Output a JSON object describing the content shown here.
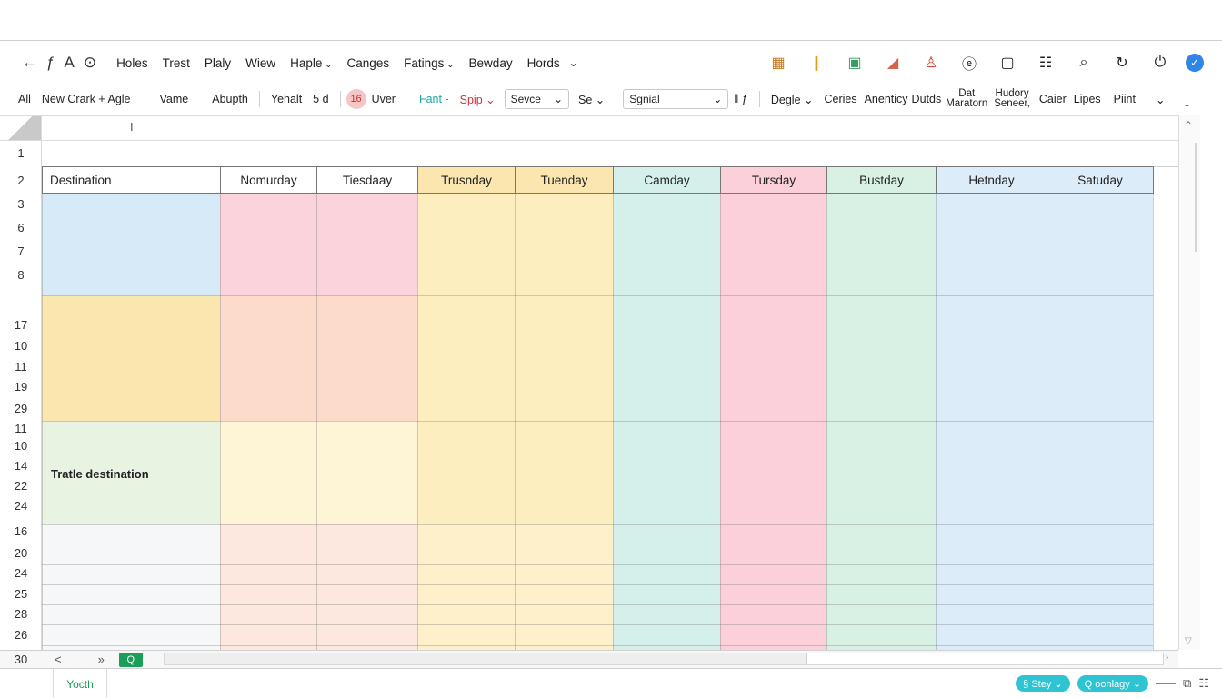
{
  "menu": {
    "nav_icons": [
      "←",
      "ƒ",
      "A",
      "⊙"
    ],
    "items": [
      {
        "label": "Holes",
        "caret": false
      },
      {
        "label": "Trest",
        "caret": false
      },
      {
        "label": "Plaly",
        "caret": false
      },
      {
        "label": "Wiew",
        "caret": false
      },
      {
        "label": "Haple",
        "caret": true
      },
      {
        "label": "Canges",
        "caret": false
      },
      {
        "label": "Fatings",
        "caret": true
      },
      {
        "label": "Bewday",
        "caret": false
      },
      {
        "label": "Hords",
        "caret": false
      }
    ],
    "more_caret": "⌄",
    "right_icons": [
      "▦",
      "❙",
      "▣",
      "◢",
      "♙",
      "ⓔ",
      "▢",
      "☷",
      "⌕",
      "↻",
      "⏻",
      "✓"
    ]
  },
  "toolbar": {
    "all": "All",
    "new_crark": "New Crark + Agle",
    "vame": "Vame",
    "abupth": "Abupth",
    "yehalt": "Yehalt",
    "five_d": "5  d",
    "pill_value": "16",
    "uver": "Uver",
    "fant": "Fant -",
    "spip": "Spip ⌄",
    "sevce": "Sevce",
    "se": "Se ⌄",
    "sgnial": "Sgnial",
    "align_icons": "‖ ƒ",
    "degle": "Degle ⌄",
    "ceries": "Ceries",
    "anenticy": "Anenticy",
    "dutds": "Dutds",
    "dat": "Dat",
    "maratorn": "Maratorn",
    "hudory": "Hudory",
    "seneer": "Seneer,",
    "caier": "Caier",
    "lipes": "Lipes",
    "pint": "Piint",
    "caret": "⌄",
    "collapse": "‸"
  },
  "formula_cursor": "I",
  "row_numbers": [
    "1",
    "2",
    "3",
    "6",
    "7",
    "8",
    "17",
    "10",
    "11",
    "19",
    "29",
    "11",
    "10",
    "14",
    "22",
    "24",
    "16",
    "20",
    "24",
    "25",
    "28",
    "26"
  ],
  "last_row": "30",
  "columns": [
    "Destination",
    "Nomurday",
    "Tiesdaay",
    "Trusnday",
    "Tuenday",
    "Camday",
    "Tursday",
    "Bustday",
    "Hetnday",
    "Satuday"
  ],
  "colors": {
    "blue": "#d6ebf7",
    "pink": "#fbd3dc",
    "yellow": "#fdeec0",
    "mint": "#d5f0ea",
    "rose": "#fbd0da",
    "green": "#d9f1e5",
    "sky": "#dcecf8",
    "amber": "#fbe6b0",
    "peach": "#fcdcc8",
    "cream": "#fdf5d6",
    "lightgreen": "#e8f3e2",
    "accent_green": "#1b9e5a",
    "accent_teal": "#2ec4d4"
  },
  "cells": {
    "traffic_destination": "Tratle destination"
  },
  "bottom": {
    "prev": "<",
    "next": "»",
    "search": "Q"
  },
  "sheet_tab": "Yocth",
  "status": {
    "chip1": "§ Stey ⌄",
    "chip2": "Q oonlagy ⌄",
    "icon1": "⧉",
    "icon2": "☷"
  }
}
